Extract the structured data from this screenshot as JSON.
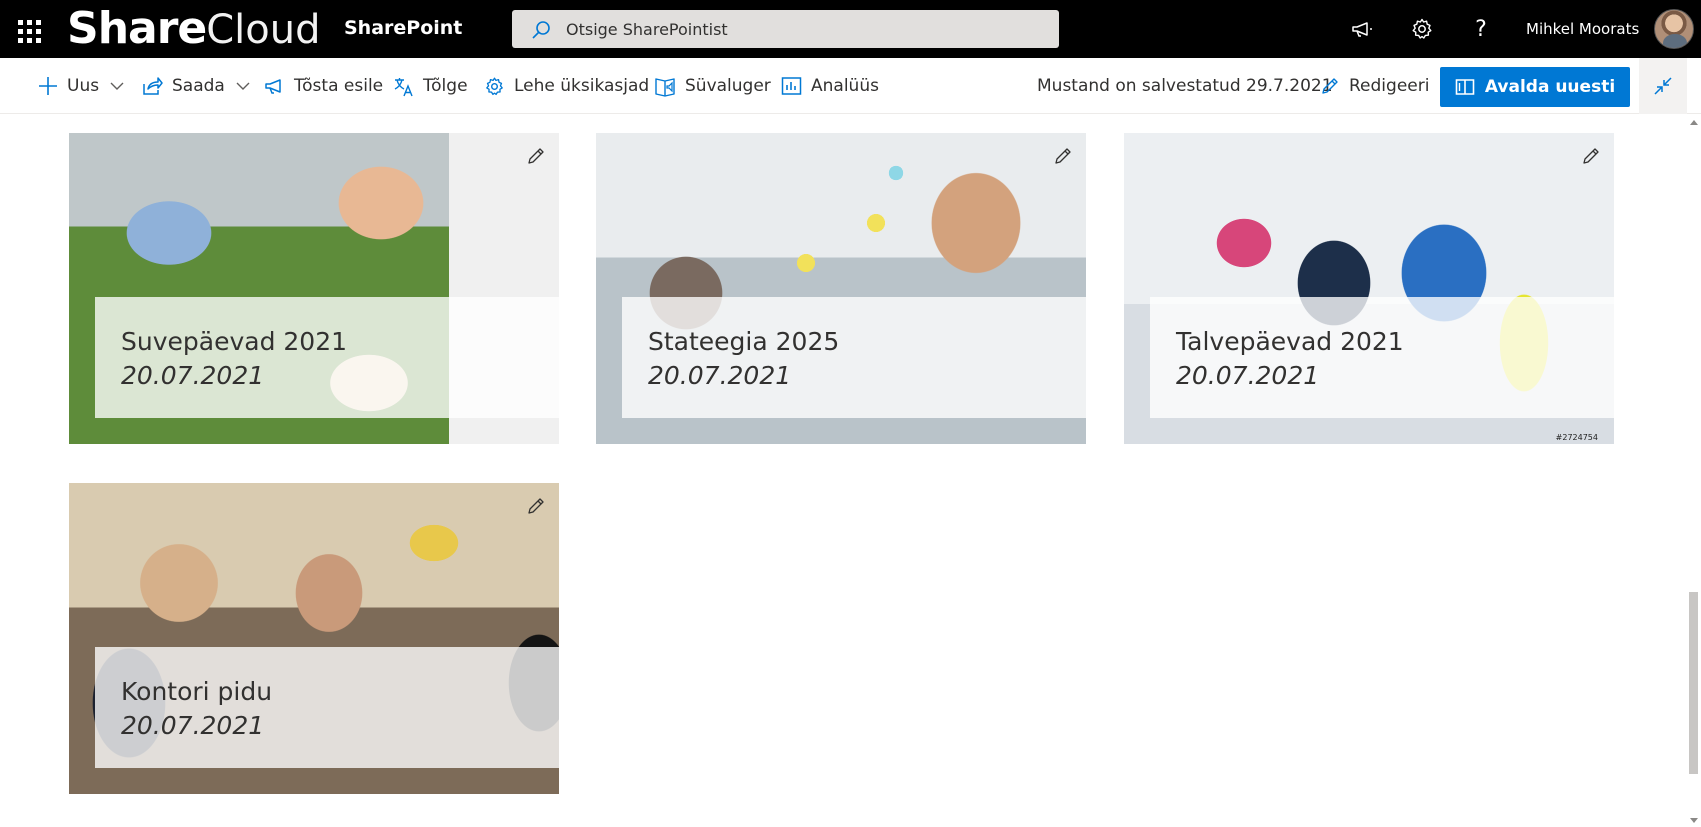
{
  "suite_bar": {
    "logo_bold": "Share",
    "logo_light": "Cloud",
    "app_name": "SharePoint",
    "search_placeholder": "Otsige SharePointist",
    "user_name": "Mihkel Moorats"
  },
  "command_bar": {
    "new_label": "Uus",
    "send_label": "Saada",
    "promote_label": "Tõsta esile",
    "translate_label": "Tõlge",
    "page_details_label": "Lehe üksikasjad",
    "immersive_reader_label": "Süvaluger",
    "analytics_label": "Analüüs",
    "draft_status": "Mustand on salvestatud 29.7.2021",
    "edit_label": "Redigeeri",
    "republish_label": "Avalda uuesti"
  },
  "cards": [
    {
      "title": "Suvepäevad 2021",
      "date": "20.07.2021"
    },
    {
      "title": "Stateegia 2025",
      "date": "20.07.2021"
    },
    {
      "title": "Talvepäevad 2021",
      "date": "20.07.2021",
      "image_caption": "#2724754"
    },
    {
      "title": "Kontori pidu",
      "date": "20.07.2021"
    }
  ],
  "colors": {
    "suite_bar": "#000000",
    "primary_button": "#0078d4",
    "icon_blue": "#0078d4"
  },
  "icons": {
    "app_launcher": "waffle-icon",
    "search": "search-icon",
    "announcements": "megaphone-icon",
    "settings": "gear-icon",
    "help": "question-icon"
  }
}
